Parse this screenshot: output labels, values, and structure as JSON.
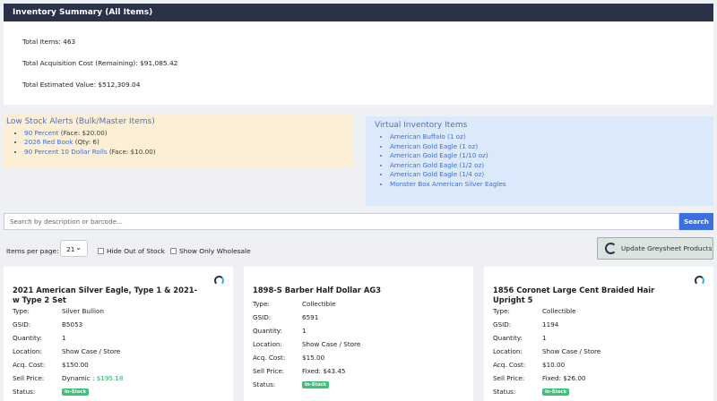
{
  "summary": {
    "title": "Inventory Summary (All Items)",
    "total_items": "Total Items: 463",
    "acquisition_cost": "Total Acquisition Cost (Remaining): $91,085.42",
    "estimated_value": "Total Estimated Value: $512,309.04"
  },
  "low_stock": {
    "title": "Low Stock Alerts (Bulk/Master Items)",
    "items": [
      {
        "name": "90 Percent",
        "detail": "(Face: $20.00)"
      },
      {
        "name": "2026 Red Book",
        "detail": "(Qty: 6)"
      },
      {
        "name": "90 Percent 10 Dollar Rolls",
        "detail": "(Face: $10.00)"
      }
    ]
  },
  "virtual": {
    "title": "Virtual Inventory Items",
    "items": [
      "American Buffalo (1 oz)",
      "American Gold Eagle (1 oz)",
      "American Gold Eagle (1/10 oz)",
      "American Gold Eagle (1/2 oz)",
      "American Gold Eagle (1/4 oz)",
      "Monster Box American Silver Eagles"
    ]
  },
  "search": {
    "placeholder": "Search by description or barcode...",
    "button": "Search"
  },
  "controls": {
    "items_per_page_label": "Items per page:",
    "items_per_page_value": "21",
    "hide_out_of_stock": "Hide Out of Stock",
    "show_only_wholesale": "Show Only Wholesale",
    "update_greysheet": "Update Greysheet Products"
  },
  "field_labels": {
    "type": "Type:",
    "gsid": "GSID:",
    "quantity": "Quantity:",
    "location": "Location:",
    "acq_cost": "Acq. Cost:",
    "sell_price": "Sell Price:",
    "status": "Status:"
  },
  "cards": [
    {
      "title": "2021 American Silver Eagle, Type 1 & 2021-w Type 2 Set",
      "type": "Silver Bullion",
      "gsid": "B5053",
      "quantity": "1",
      "location": "Show Case / Store",
      "acq_cost": "$150.00",
      "sell_prefix": "Dynamic : ",
      "sell_value": "$195.18",
      "status": "In-Stock"
    },
    {
      "title": "1898-S Barber Half Dollar AG3",
      "type": "Collectible",
      "gsid": "6591",
      "quantity": "1",
      "location": "Show Case / Store",
      "acq_cost": "$15.00",
      "sell_prefix": "Fixed: $43.45",
      "sell_value": "",
      "status": "In-Stock"
    },
    {
      "title": "1856 Coronet Large Cent Braided Hair Upright 5",
      "type": "Collectible",
      "gsid": "1194",
      "quantity": "1",
      "location": "Show Case / Store",
      "acq_cost": "$10.00",
      "sell_prefix": "Fixed: $26.00",
      "sell_value": "",
      "status": "In-Stock"
    }
  ],
  "colors": {
    "header_bg": "#2b3247",
    "accent_blue": "#3c6fe0",
    "low_stock_bg": "#fcefd5",
    "virtual_bg": "#dce9fb",
    "in_stock": "#3cc07a"
  }
}
